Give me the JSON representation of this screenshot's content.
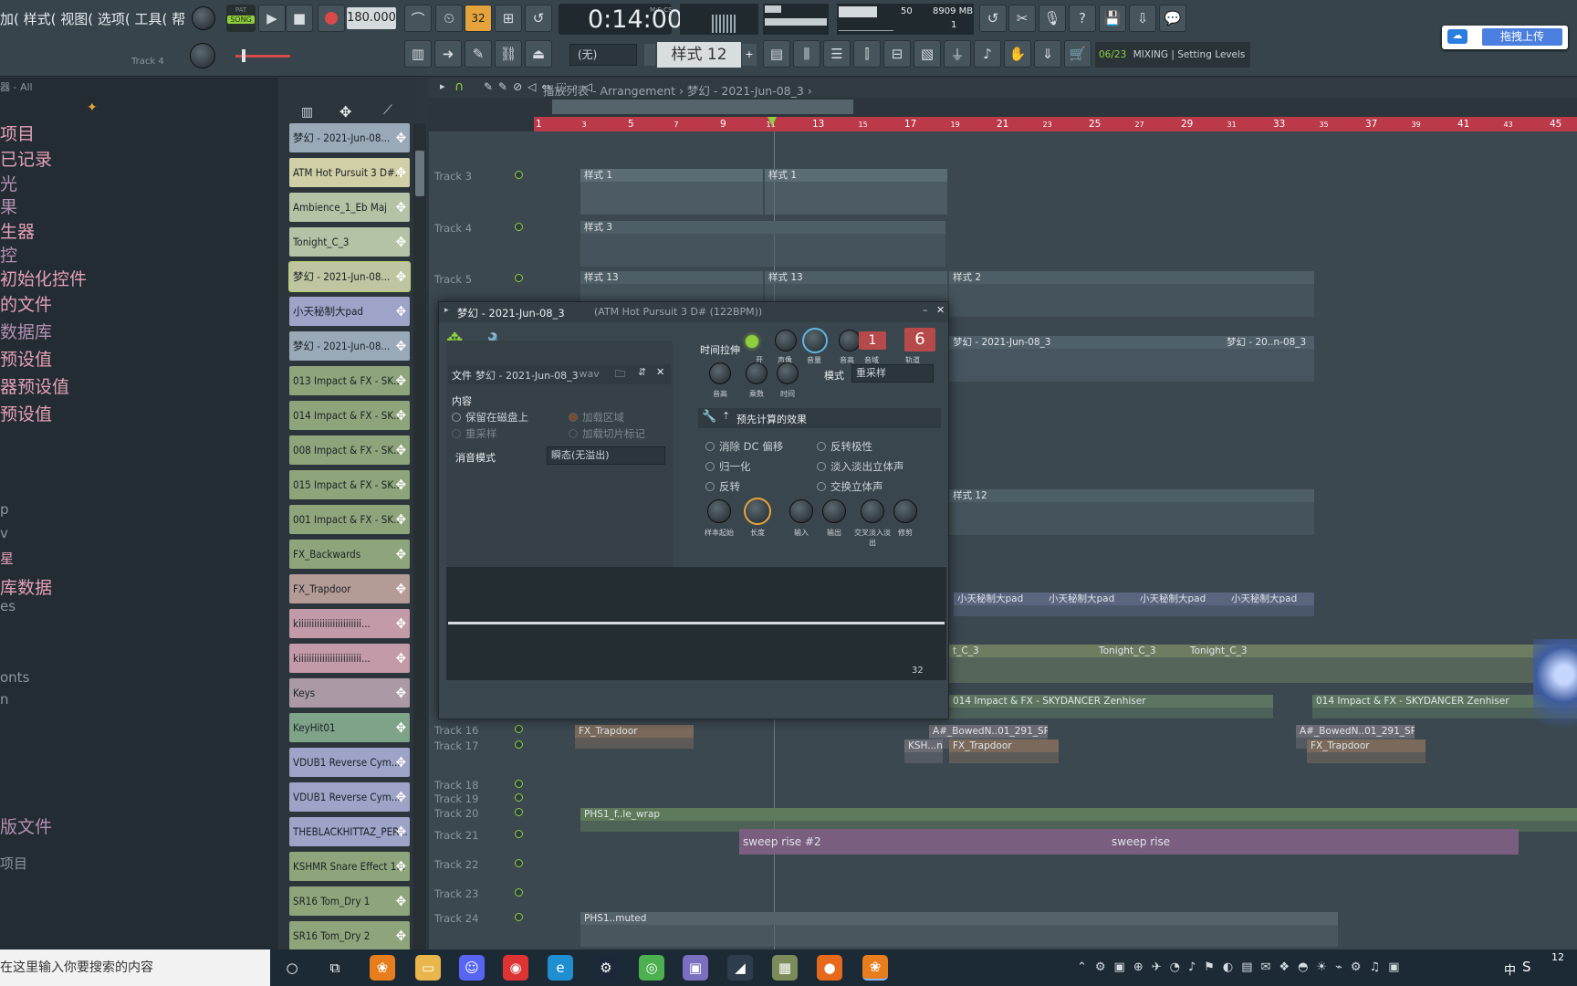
{
  "menu": "加( 样式( 视图( 选项( 工具( 帮",
  "transport": {
    "pat": "PAT",
    "song": "SONG",
    "tempo": "180.000",
    "time": "0:14:00",
    "time_unit": "M:S:CS",
    "cpu_val": "50",
    "mem": "8909 MB",
    "mem_sub": "1"
  },
  "hint": {
    "track_label": "Track 4"
  },
  "toolbar2": {
    "snap": "(无)",
    "pattern": "样式 12",
    "mixing_step": "06/23",
    "mixing_text": "MIXING | Setting Levels"
  },
  "upload_button": "拖拽上传",
  "browser": {
    "header": "器 - All",
    "items": [
      "项目",
      "已记录",
      "光",
      "果",
      "生器",
      "控",
      "初始化控件",
      "的文件",
      "数据库",
      "预设值",
      "器预设值",
      "预设值",
      "",
      "",
      "p",
      "v",
      "星",
      "库数据",
      "es",
      "",
      "onts",
      "n",
      "",
      "版文件",
      "项目"
    ]
  },
  "channels": [
    "梦幻 - 2021-Jun-08...",
    "ATM Hot Pursuit 3 D#...",
    "Ambience_1_Eb Maj",
    "Tonight_C_3",
    "梦幻 - 2021-Jun-08...",
    "小天秘制大pad",
    "梦幻 - 2021-Jun-08...",
    "013 Impact & FX - SK...",
    "014 Impact & FX - SK...",
    "008 Impact & FX - SK...",
    "015 Impact & FX - SK...",
    "001 Impact & FX - SK...",
    "FX_Backwards",
    "FX_Trapdoor",
    "kiiiiiiiiiiiiiiiiiiiiiiii...",
    "kiiiiiiiiiiiiiiiiiiiiiiii...",
    "Keys",
    "KeyHit01",
    "VDUB1 Reverse Cym...",
    "VDUB1 Reverse Cym...",
    "THEBLACKHITTAZ_PER...",
    "KSHMR Snare Effect 1...",
    "SR16 Tom_Dry 1",
    "SR16 Tom_Dry 2"
  ],
  "playlist": {
    "breadcrumb": "播放列表 - Arrangement › 梦幻 - 2021-Jun-08_3 ›",
    "ruler": [
      "1",
      "3",
      "5",
      "7",
      "9",
      "11",
      "13",
      "15",
      "17",
      "19",
      "21",
      "23",
      "25",
      "27",
      "29",
      "31",
      "33",
      "35",
      "37",
      "39",
      "41",
      "43",
      "45"
    ],
    "tracks": [
      "Track 3",
      "Track 4",
      "Track 5",
      "Track 16",
      "Track 17",
      "Track 18",
      "Track 19",
      "Track 20",
      "Track 21",
      "Track 22",
      "Track 23",
      "Track 24"
    ],
    "clips": [
      "样式 1",
      "样式 1",
      "样式 3",
      "样式 13",
      "样式 13",
      "样式 2",
      "梦幻 - 2021-Jun-08_3",
      "梦幻 - 20..n-08_3",
      "样式 12",
      "小天秘制大pad",
      "小天秘制大pad",
      "小天秘制大pad",
      "小天秘制大pad",
      "t_C_3",
      "Tonight_C_3",
      "Tonight_C_3",
      "014 Impact & FX - SKYDANCER Zenhiser",
      "014 Impact & FX - SKYDANCER Zenhiser",
      "FX_Trapdoor",
      "A#_BowedN..01_291_SP",
      "A#_BowedN..01_291_SP",
      "KSH...n",
      "FX_Trapdoor",
      "FX_Trapdoor",
      "PHS1_f..le_wrap",
      "sweep rise #2",
      "sweep rise",
      "PHS1..muted"
    ]
  },
  "sampler": {
    "title": "梦幻 - 2021-Jun-08_3",
    "subtitle": "(ATM Hot Pursuit 3 D# (122BPM))",
    "file_label": "文件",
    "file_name": "梦幻 - 2021-Jun-08_3",
    "file_ext": ".wav",
    "content_label": "内容",
    "keep_disk": "保留在磁盘上",
    "resample": "重采样",
    "load_region": "加载区域",
    "load_slice": "加载切片标记",
    "declick_label": "消音模式",
    "declick_value": "瞬态(无溢出)",
    "stretch_label": "时间拉伸",
    "mode_label": "模式",
    "mode_value": "重采样",
    "precomp_label": "预先计算的效果",
    "fx": [
      "消除 DC 偏移",
      "反转极性",
      "归一化",
      "淡入淡出立体声",
      "反转",
      "交换立体声"
    ],
    "knobs_top": [
      "开",
      "声像",
      "音量",
      "音高",
      "音域",
      "轨道"
    ],
    "stretch_knobs": [
      "音高",
      "乘数",
      "时间"
    ],
    "fx_knobs": [
      "样本起始",
      "长度",
      "输入",
      "输出",
      "交叉淡入淡出",
      "修剪"
    ],
    "pitch_val": "1",
    "track_val": "6",
    "wave_zoom": "32"
  },
  "taskbar": {
    "search": "在这里输入你要搜索的内容",
    "ime": "中",
    "clock": "12"
  },
  "colors": {
    "ruler": "#bb3949",
    "accent": "#e5a43b",
    "green": "#7ec24b"
  }
}
